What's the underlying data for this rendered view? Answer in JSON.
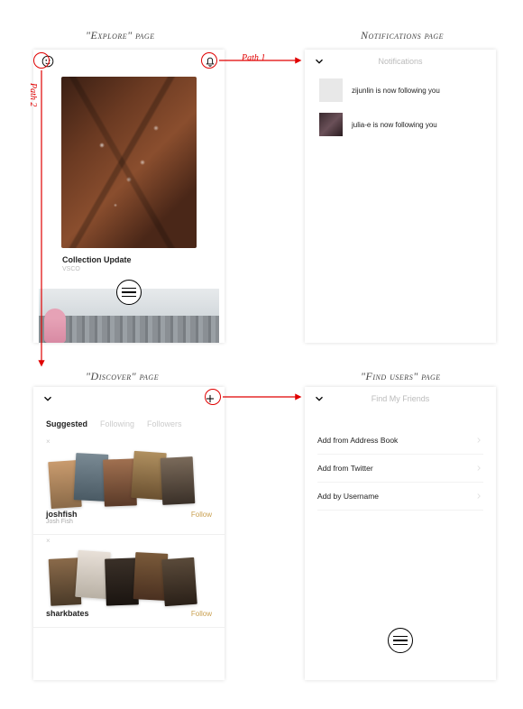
{
  "labels": {
    "explore": "\"Explore\" page",
    "notifications": "Notifications page",
    "discover": "\"Discover\" page",
    "find": "\"Find users\" page",
    "path1": "Path 1",
    "path2": "Path 2"
  },
  "explore": {
    "card_title": "Collection Update",
    "card_source": "VSCO"
  },
  "notifications": {
    "header": "Notifications",
    "items": [
      {
        "text": "zijunlin is now following you"
      },
      {
        "text": "julia-e is now following you"
      }
    ]
  },
  "discover": {
    "tabs": {
      "suggested": "Suggested",
      "following": "Following",
      "followers": "Followers"
    },
    "users": [
      {
        "username": "joshfish",
        "fullname": "Josh Fish",
        "action": "Follow"
      },
      {
        "username": "sharkbates",
        "fullname": "",
        "action": "Follow"
      }
    ]
  },
  "find": {
    "header": "Find My Friends",
    "options": [
      {
        "label": "Add from Address Book"
      },
      {
        "label": "Add from Twitter"
      },
      {
        "label": "Add by Username"
      }
    ]
  }
}
